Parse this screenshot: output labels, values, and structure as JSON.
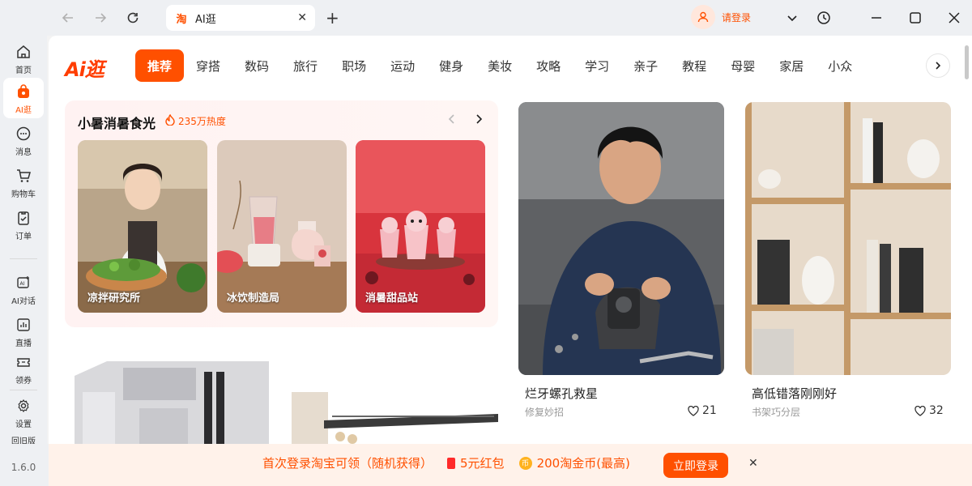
{
  "browser": {
    "tab_title": "AI逛",
    "tab_logo": "淘",
    "login_label": "请登录"
  },
  "sidebar": {
    "items": [
      {
        "label": "首页",
        "icon": "home-icon"
      },
      {
        "label": "AI逛",
        "icon": "bag-icon"
      },
      {
        "label": "消息",
        "icon": "chat-icon"
      },
      {
        "label": "购物车",
        "icon": "cart-icon"
      },
      {
        "label": "订单",
        "icon": "order-icon"
      },
      {
        "label": "AI对话",
        "icon": "ai-chat-icon"
      },
      {
        "label": "直播",
        "icon": "live-icon"
      },
      {
        "label": "领券",
        "icon": "coupon-icon"
      },
      {
        "label": "设置",
        "icon": "settings-icon"
      },
      {
        "label": "回旧版",
        "icon": ""
      }
    ],
    "version": "1.6.0"
  },
  "header": {
    "brand": "Ai逛",
    "categories": [
      "推荐",
      "穿搭",
      "数码",
      "旅行",
      "职场",
      "运动",
      "健身",
      "美妆",
      "攻略",
      "学习",
      "亲子",
      "教程",
      "母婴",
      "家居",
      "小众"
    ],
    "active_category": "推荐"
  },
  "topic": {
    "title": "小暑消暑食光",
    "heat": "235万热度",
    "cards": [
      {
        "label": "凉拌研究所"
      },
      {
        "label": "冰饮制造局"
      },
      {
        "label": "消暑甜品站"
      }
    ]
  },
  "feed": [
    {
      "title": "烂牙螺孔救星",
      "subtitle": "修复妙招",
      "likes": "21"
    },
    {
      "title": "高低错落刚刚好",
      "subtitle": "书架巧分层",
      "likes": "32"
    }
  ],
  "banner": {
    "text1": "首次登录淘宝可领（随机获得）",
    "text2": "5元红包",
    "text3": "200淘金币(最高)",
    "coin_glyph": "币",
    "cta": "立即登录"
  },
  "colors": {
    "accent": "#ff5000",
    "sidebar_bg": "#eef0f3"
  }
}
